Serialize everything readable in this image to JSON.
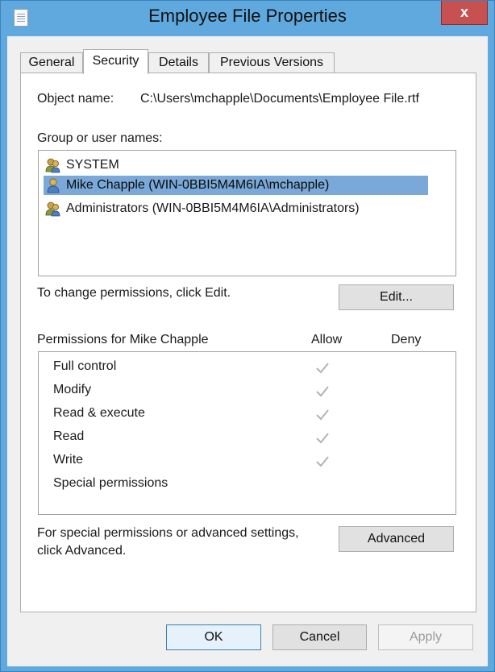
{
  "window": {
    "title": "Employee File Properties",
    "close_label": "x"
  },
  "tabs": [
    {
      "label": "General",
      "active": false
    },
    {
      "label": "Security",
      "active": true
    },
    {
      "label": "Details",
      "active": false
    },
    {
      "label": "Previous Versions",
      "active": false
    }
  ],
  "object": {
    "label": "Object name:",
    "value": "C:\\Users\\mchapple\\Documents\\Employee File.rtf"
  },
  "groups": {
    "label": "Group or user names:",
    "items": [
      {
        "name": "SYSTEM",
        "icon": "group-users-icon",
        "selected": false
      },
      {
        "name": "Mike Chapple (WIN-0BBI5M4M6IA\\mchapple)",
        "icon": "user-icon",
        "selected": true
      },
      {
        "name": "Administrators (WIN-0BBI5M4M6IA\\Administrators)",
        "icon": "group-users-icon",
        "selected": false
      }
    ]
  },
  "change_text": "To change permissions, click Edit.",
  "edit_label": "Edit...",
  "permissions": {
    "header": "Permissions for Mike Chapple",
    "allow_label": "Allow",
    "deny_label": "Deny",
    "rows": [
      {
        "name": "Full control",
        "allow": true,
        "deny": false
      },
      {
        "name": "Modify",
        "allow": true,
        "deny": false
      },
      {
        "name": "Read & execute",
        "allow": true,
        "deny": false
      },
      {
        "name": "Read",
        "allow": true,
        "deny": false
      },
      {
        "name": "Write",
        "allow": true,
        "deny": false
      },
      {
        "name": "Special permissions",
        "allow": false,
        "deny": false
      }
    ]
  },
  "advanced": {
    "text_line1": "For special permissions or advanced settings,",
    "text_line2": "click Advanced.",
    "button_label": "Advanced"
  },
  "footer": {
    "ok_label": "OK",
    "cancel_label": "Cancel",
    "apply_label": "Apply"
  },
  "colors": {
    "title_bar": "#5fa9de",
    "close_button": "#c75050",
    "selection": "#7aa9d9",
    "check_gray": "#b3b3b3"
  }
}
